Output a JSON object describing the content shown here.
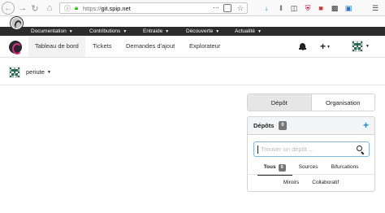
{
  "browser": {
    "url_host": "git.spip.net",
    "url_scheme": "https://",
    "more_icon": "ellipsis-icon",
    "pocket_icon": "pocket-icon",
    "bookmark_icon": "star-icon",
    "toolbar_icons": [
      "download-icon",
      "library-icon",
      "sidebar-icon",
      "ublock-icon",
      "extension-icon",
      "extension-icon",
      "menu-icon"
    ]
  },
  "site_nav": {
    "items": [
      {
        "label": "Documentation"
      },
      {
        "label": "Contributions"
      },
      {
        "label": "Entraide"
      },
      {
        "label": "Découverte"
      },
      {
        "label": "Actualité"
      }
    ]
  },
  "header": {
    "tabs": [
      {
        "label": "Tableau de bord",
        "active": true
      },
      {
        "label": "Tickets",
        "active": false
      },
      {
        "label": "Demandes d'ajout",
        "active": false
      },
      {
        "label": "Explorateur",
        "active": false
      }
    ],
    "notification_icon": "bell-icon",
    "create_label": "+",
    "avatar_icon": "identicon-avatar"
  },
  "context": {
    "username": "periute"
  },
  "panel": {
    "segments": [
      {
        "label": "Dépôt",
        "active": true
      },
      {
        "label": "Organisation",
        "active": false
      }
    ],
    "repos": {
      "title": "Dépôts",
      "count": "0",
      "add_label": "+",
      "search_placeholder": "Trouver un dépôt …",
      "filters_row1": [
        {
          "label": "Tous",
          "badge": "0",
          "active": true
        },
        {
          "label": "Sources",
          "badge": "",
          "active": false
        },
        {
          "label": "Bifurcations",
          "badge": "",
          "active": false
        }
      ],
      "filters_row2": [
        {
          "label": "Miroirs",
          "badge": "",
          "active": false
        },
        {
          "label": "Collaboratif",
          "badge": "",
          "active": false
        }
      ]
    }
  },
  "colors": {
    "site_nav_bg": "#2c2c2c",
    "accent_blue": "#2185d0",
    "badge_grey": "#767676",
    "gitea_pink": "#d5307c",
    "identicon_green": "#2e6b55"
  }
}
